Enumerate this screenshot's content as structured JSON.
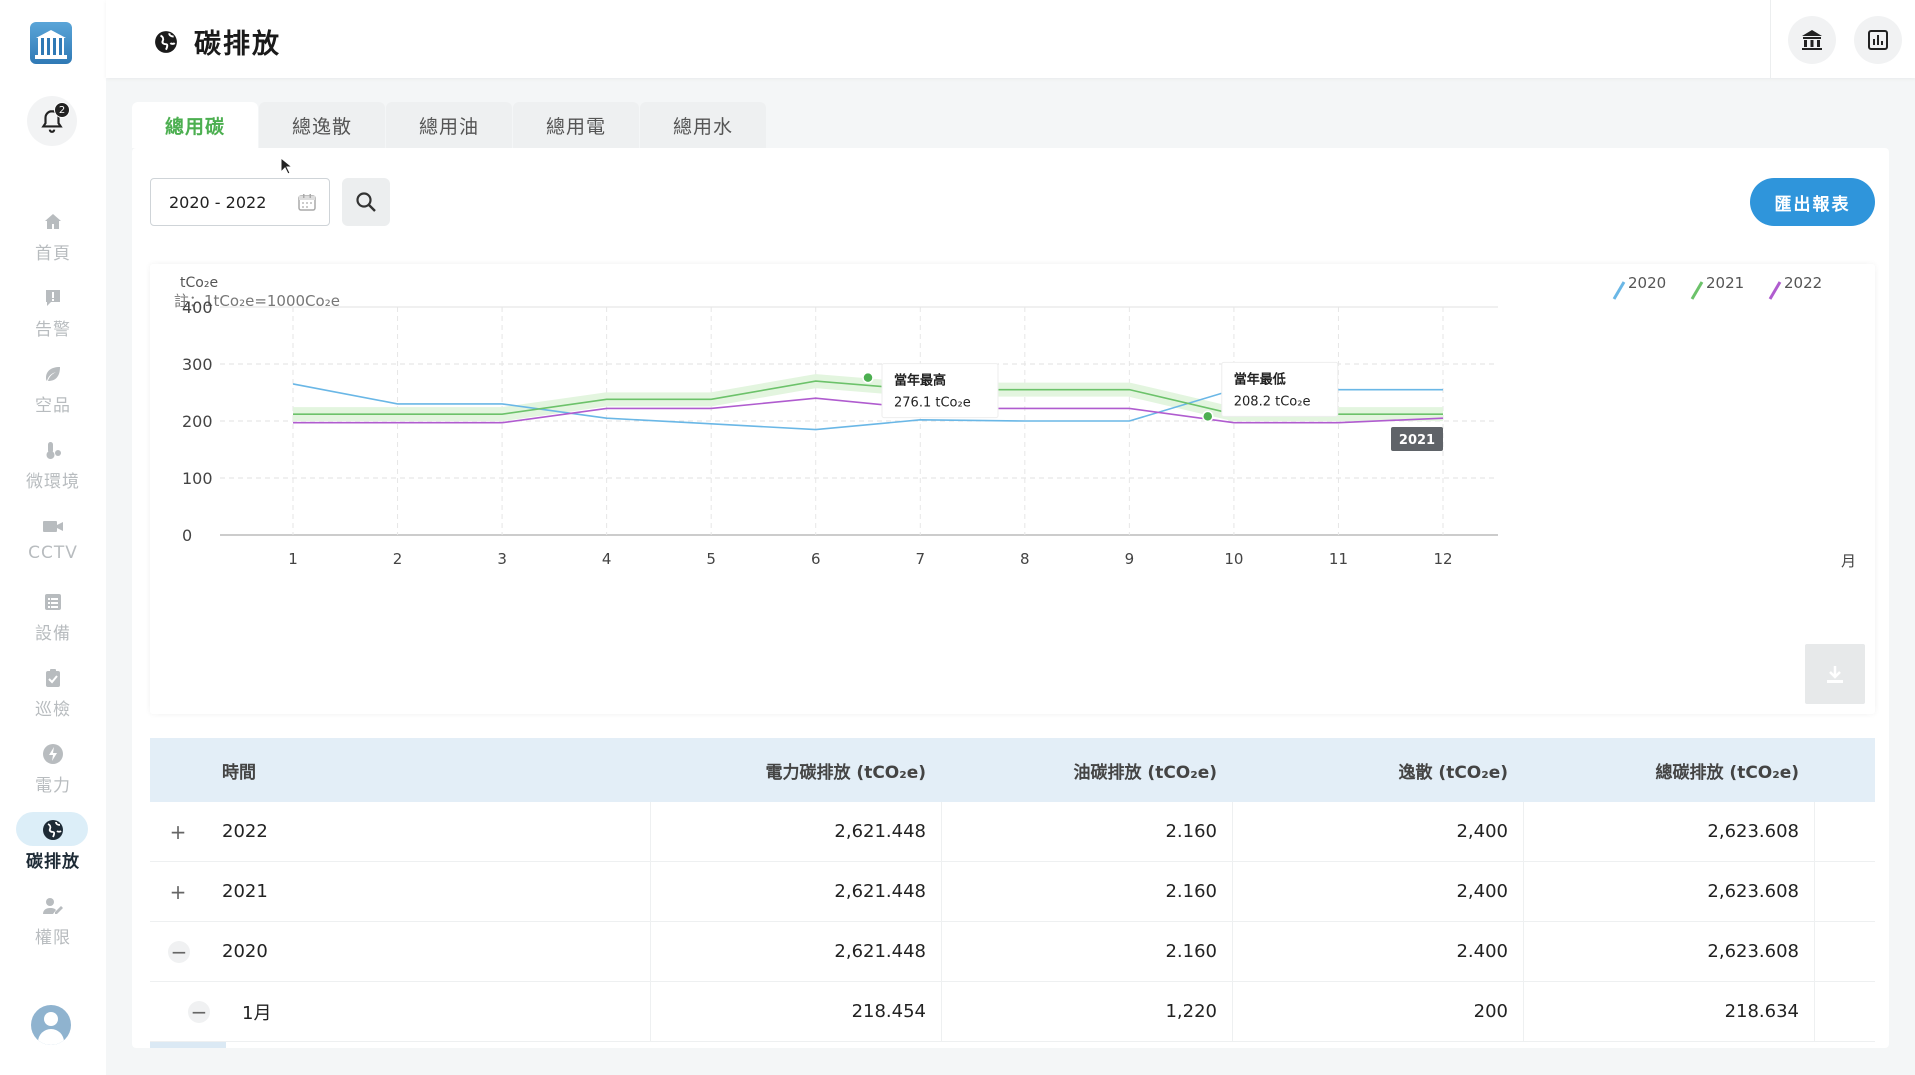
{
  "sidebar": {
    "notification_count": "2",
    "items": [
      {
        "label": "首頁",
        "icon": "home-icon"
      },
      {
        "label": "告警",
        "icon": "alert-icon"
      },
      {
        "label": "空品",
        "icon": "leaf-icon"
      },
      {
        "label": "微環境",
        "icon": "thermometer-icon"
      },
      {
        "label": "CCTV",
        "icon": "camera-icon"
      },
      {
        "label": "設備",
        "icon": "list-icon"
      },
      {
        "label": "巡檢",
        "icon": "checklist-icon"
      },
      {
        "label": "電力",
        "icon": "lightning-icon"
      },
      {
        "label": "碳排放",
        "icon": "globe-icon",
        "active": true
      },
      {
        "label": "權限",
        "icon": "user-key-icon"
      }
    ]
  },
  "header": {
    "title": "碳排放"
  },
  "tabs": [
    {
      "label": "總用碳",
      "active": true
    },
    {
      "label": "總逸散"
    },
    {
      "label": "總用油"
    },
    {
      "label": "總用電"
    },
    {
      "label": "總用水"
    }
  ],
  "filter": {
    "date_range": "2020 - 2022",
    "export_label": "匯出報表"
  },
  "chart_note": "註：1tCo₂e=1000Co₂e",
  "chart_data": {
    "type": "line",
    "ylabel": "tCo₂e",
    "xlabel": "月",
    "ylim": [
      0,
      400
    ],
    "yticks": [
      0,
      100,
      200,
      300,
      400
    ],
    "x": [
      1,
      2,
      3,
      4,
      5,
      6,
      7,
      8,
      9,
      10,
      11,
      12
    ],
    "legend_position": "top-right",
    "grid": true,
    "series": [
      {
        "name": "2020",
        "color": "#6ab7e6",
        "values": [
          265,
          230,
          230,
          205,
          195,
          185,
          202,
          200,
          200,
          255,
          255,
          255
        ]
      },
      {
        "name": "2021",
        "color": "#6cc26a",
        "values": [
          212,
          212,
          212,
          238,
          238,
          270,
          255,
          255,
          255,
          212,
          212,
          212
        ]
      },
      {
        "name": "2022",
        "color": "#b05ccf",
        "values": [
          197,
          197,
          197,
          222,
          222,
          240,
          222,
          222,
          222,
          197,
          197,
          205
        ]
      }
    ],
    "annotations": [
      {
        "title": "當年最高",
        "value": "276.1 tCo₂e",
        "x": 6.5,
        "y": 276.1
      },
      {
        "title": "當年最低",
        "value": "208.2 tCo₂e",
        "x": 9.75,
        "y": 208.2
      }
    ],
    "hover_label": "2021"
  },
  "table": {
    "headers": [
      "時間",
      "電力碳排放 (tCO₂e)",
      "油碳排放 (tCO₂e)",
      "逸散 (tCO₂e)",
      "總碳排放 (tCO₂e)"
    ],
    "rows": [
      {
        "time": "2022",
        "power": "2,621.448",
        "oil": "2.160",
        "fugitive": "2,400",
        "total": "2,623.608",
        "state": "collapsed"
      },
      {
        "time": "2021",
        "power": "2,621.448",
        "oil": "2.160",
        "fugitive": "2,400",
        "total": "2,623.608",
        "state": "collapsed"
      },
      {
        "time": "2020",
        "power": "2,621.448",
        "oil": "2.160",
        "fugitive": "2.400",
        "total": "2,623.608",
        "state": "expanded"
      },
      {
        "time": "1月",
        "power": "218.454",
        "oil": "1,220",
        "fugitive": "200",
        "total": "218.634",
        "state": "expanded"
      }
    ]
  }
}
